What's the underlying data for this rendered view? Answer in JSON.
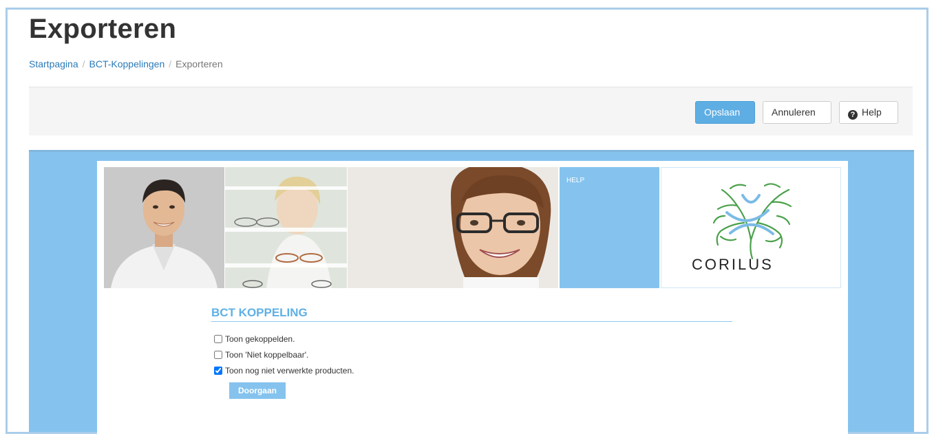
{
  "page": {
    "title": "Exporteren"
  },
  "breadcrumb": {
    "items": [
      "Startpagina",
      "BCT-Koppelingen"
    ],
    "current": "Exporteren",
    "separator": "/"
  },
  "toolbar": {
    "save_label": "Opslaan",
    "cancel_label": "Annuleren",
    "help_label": "Help"
  },
  "banner": {
    "help_label": "HELP",
    "logo_text": "CORILUS"
  },
  "bct": {
    "title": "BCT KOPPELING",
    "options": [
      {
        "label": "Toon gekoppelden.",
        "checked": false
      },
      {
        "label": "Toon 'Niet koppelbaar'.",
        "checked": false
      },
      {
        "label": "Toon nog niet verwerkte producten.",
        "checked": true
      }
    ],
    "continue_label": "Doorgaan"
  },
  "colors": {
    "accent": "#5eaee4",
    "panel_blue": "#85c3ee",
    "link": "#2a7ab8",
    "logo_green": "#4aa04a",
    "logo_blue": "#7bbbe6"
  }
}
